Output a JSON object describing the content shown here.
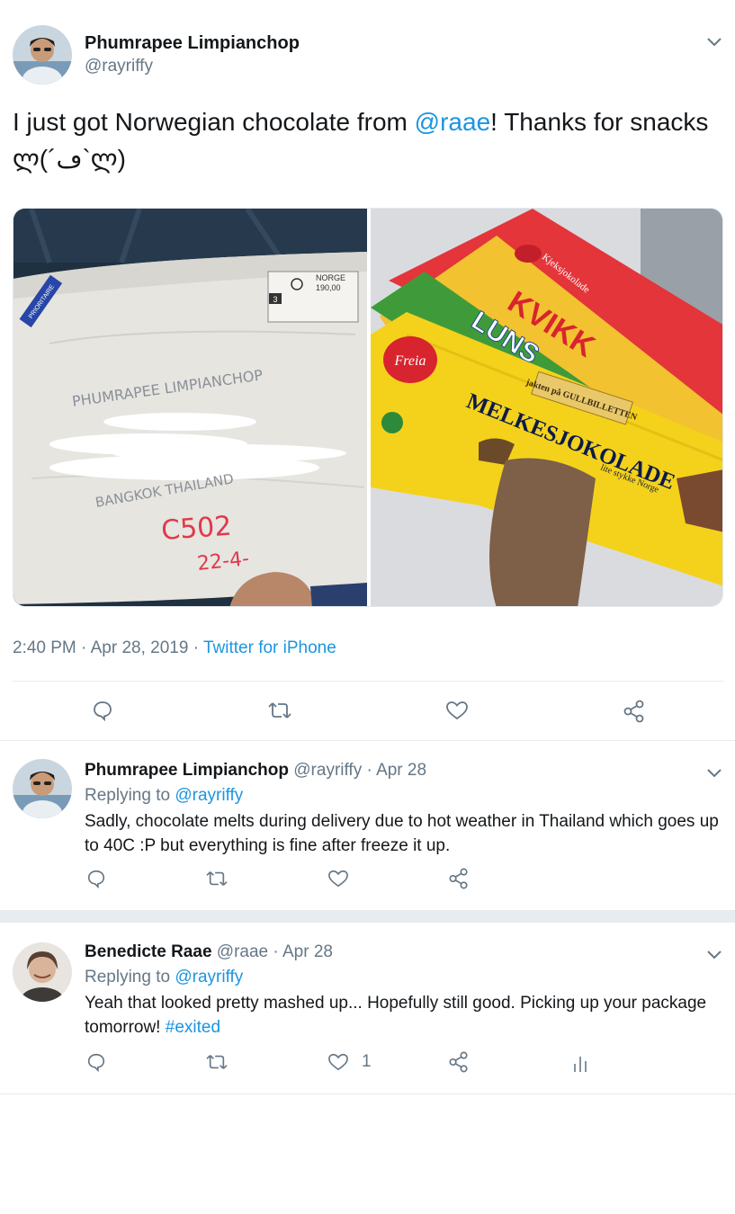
{
  "main_tweet": {
    "author_name": "Phumrapee Limpianchop",
    "handle": "@rayriffy",
    "text_before": "I just got Norwegian chocolate from ",
    "mention": "@raae",
    "text_after": "! Thanks for snacks ლ(´ڡ`ლ)",
    "photos": [
      {
        "description": "Envelope photo",
        "envelope_name": "PHUMRAPEE LIMPIANCHOP",
        "envelope_city": "BANGKOK THAILAND",
        "envelope_room": "C502",
        "envelope_date": "22-4-",
        "stamp_country": "NORGE",
        "stamp_value": "190,00",
        "stamp_box": "3",
        "label_text": "PRIORITAIRE"
      },
      {
        "description": "Chocolate bars photo",
        "brand": "Freia",
        "bar1": "KVIKK",
        "bar1_sub": "LUNS",
        "bar1_tag": "Kjeksjokolade",
        "bar2": "MELKESJOKOLADE",
        "bar2_tag": "jakten på GULLBILLETTEN",
        "bar2_sub": "lite stykke Norge"
      }
    ],
    "time": "2:40 PM",
    "date": "Apr 28, 2019",
    "source": "Twitter for iPhone",
    "sep": "·"
  },
  "replies": [
    {
      "author_name": "Phumrapee Limpianchop",
      "handle": "@rayriffy",
      "date": "Apr 28",
      "replying_label": "Replying to ",
      "replying_to": "@rayriffy",
      "text": "Sadly, chocolate melts during delivery due to hot weather in Thailand which goes up to 40C :P but everything is fine after freeze it up.",
      "like_count": ""
    },
    {
      "author_name": "Benedicte Raae",
      "handle": "@raae",
      "date": "Apr 28",
      "replying_label": "Replying to ",
      "replying_to": "@rayriffy",
      "text_before": "Yeah that looked pretty mashed up... Hopefully still good. Picking up your package tomorrow! ",
      "hashtag": "#exited",
      "like_count": "1"
    }
  ],
  "colors": {
    "link": "#1b95e0",
    "muted": "#657786",
    "text": "#14171a",
    "divider": "#e6ecf0"
  },
  "icons": [
    "reply-icon",
    "retweet-icon",
    "like-icon",
    "share-icon",
    "analytics-icon",
    "chevron-down-icon"
  ]
}
